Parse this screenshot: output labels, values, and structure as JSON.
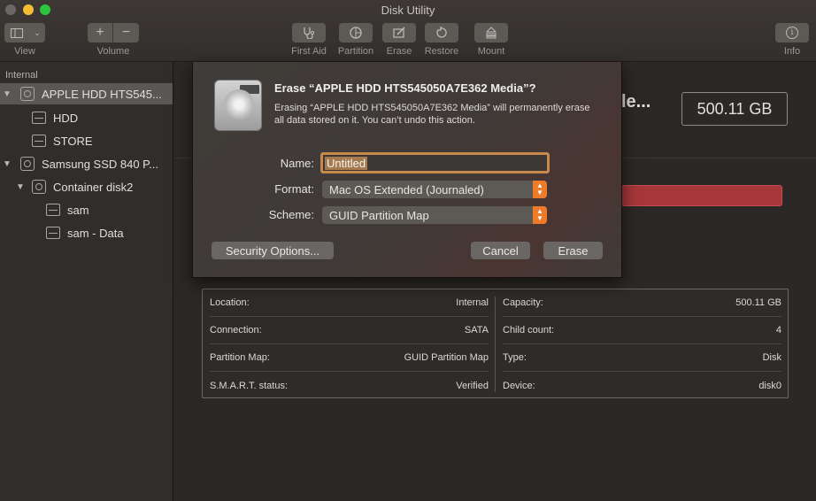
{
  "window": {
    "title": "Disk Utility"
  },
  "toolbar": {
    "view_label": "View",
    "volume_label": "Volume",
    "first_aid_label": "First Aid",
    "partition_label": "Partition",
    "erase_label": "Erase",
    "restore_label": "Restore",
    "mount_label": "Mount",
    "info_label": "Info",
    "volume_add": "+",
    "volume_remove": "−",
    "info_symbol": "i"
  },
  "sidebar": {
    "section": "Internal",
    "items": [
      {
        "label": "APPLE HDD HTS545...",
        "level": 0,
        "icon": "disk-icon",
        "selected": true
      },
      {
        "label": "HDD",
        "level": 1,
        "icon": "volume-icon"
      },
      {
        "label": "STORE",
        "level": 1,
        "icon": "volume-icon"
      },
      {
        "label": "Samsung SSD 840 P...",
        "level": 0,
        "icon": "disk-icon"
      },
      {
        "label": "Container disk2",
        "level": 1,
        "icon": "disk-icon"
      },
      {
        "label": "sam",
        "level": 2,
        "icon": "volume-icon"
      },
      {
        "label": "sam - Data",
        "level": 2,
        "icon": "volume-icon"
      }
    ]
  },
  "main": {
    "name_truncated": "le...",
    "capacity": "500.11 GB",
    "info_left": [
      {
        "key": "Location:",
        "value": "Internal"
      },
      {
        "key": "Connection:",
        "value": "SATA"
      },
      {
        "key": "Partition Map:",
        "value": "GUID Partition Map"
      },
      {
        "key": "S.M.A.R.T. status:",
        "value": "Verified"
      }
    ],
    "info_right": [
      {
        "key": "Capacity:",
        "value": "500.11 GB"
      },
      {
        "key": "Child count:",
        "value": "4"
      },
      {
        "key": "Type:",
        "value": "Disk"
      },
      {
        "key": "Device:",
        "value": "disk0"
      }
    ]
  },
  "dialog": {
    "title": "Erase “APPLE HDD HTS545050A7E362 Media”?",
    "message": "Erasing “APPLE HDD HTS545050A7E362 Media” will permanently erase all data stored on it. You can’t undo this action.",
    "name_label": "Name:",
    "name_value": "Untitled",
    "format_label": "Format:",
    "format_value": "Mac OS Extended (Journaled)",
    "scheme_label": "Scheme:",
    "scheme_value": "GUID Partition Map",
    "security_button": "Security Options...",
    "cancel_button": "Cancel",
    "erase_button": "Erase"
  },
  "colors": {
    "accent_orange": "#ee7b2a",
    "erase_highlight": "#a8373a"
  }
}
